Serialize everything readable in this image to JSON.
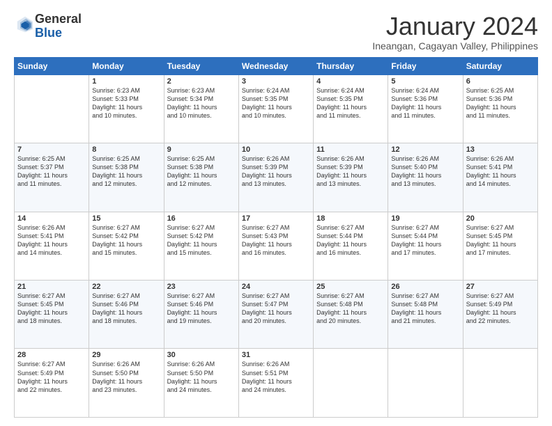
{
  "logo": {
    "general": "General",
    "blue": "Blue"
  },
  "title": "January 2024",
  "location": "Ineangan, Cagayan Valley, Philippines",
  "headers": [
    "Sunday",
    "Monday",
    "Tuesday",
    "Wednesday",
    "Thursday",
    "Friday",
    "Saturday"
  ],
  "weeks": [
    [
      {
        "day": "",
        "info": ""
      },
      {
        "day": "1",
        "info": "Sunrise: 6:23 AM\nSunset: 5:33 PM\nDaylight: 11 hours\nand 10 minutes."
      },
      {
        "day": "2",
        "info": "Sunrise: 6:23 AM\nSunset: 5:34 PM\nDaylight: 11 hours\nand 10 minutes."
      },
      {
        "day": "3",
        "info": "Sunrise: 6:24 AM\nSunset: 5:35 PM\nDaylight: 11 hours\nand 10 minutes."
      },
      {
        "day": "4",
        "info": "Sunrise: 6:24 AM\nSunset: 5:35 PM\nDaylight: 11 hours\nand 11 minutes."
      },
      {
        "day": "5",
        "info": "Sunrise: 6:24 AM\nSunset: 5:36 PM\nDaylight: 11 hours\nand 11 minutes."
      },
      {
        "day": "6",
        "info": "Sunrise: 6:25 AM\nSunset: 5:36 PM\nDaylight: 11 hours\nand 11 minutes."
      }
    ],
    [
      {
        "day": "7",
        "info": "Sunrise: 6:25 AM\nSunset: 5:37 PM\nDaylight: 11 hours\nand 11 minutes."
      },
      {
        "day": "8",
        "info": "Sunrise: 6:25 AM\nSunset: 5:38 PM\nDaylight: 11 hours\nand 12 minutes."
      },
      {
        "day": "9",
        "info": "Sunrise: 6:25 AM\nSunset: 5:38 PM\nDaylight: 11 hours\nand 12 minutes."
      },
      {
        "day": "10",
        "info": "Sunrise: 6:26 AM\nSunset: 5:39 PM\nDaylight: 11 hours\nand 13 minutes."
      },
      {
        "day": "11",
        "info": "Sunrise: 6:26 AM\nSunset: 5:39 PM\nDaylight: 11 hours\nand 13 minutes."
      },
      {
        "day": "12",
        "info": "Sunrise: 6:26 AM\nSunset: 5:40 PM\nDaylight: 11 hours\nand 13 minutes."
      },
      {
        "day": "13",
        "info": "Sunrise: 6:26 AM\nSunset: 5:41 PM\nDaylight: 11 hours\nand 14 minutes."
      }
    ],
    [
      {
        "day": "14",
        "info": "Sunrise: 6:26 AM\nSunset: 5:41 PM\nDaylight: 11 hours\nand 14 minutes."
      },
      {
        "day": "15",
        "info": "Sunrise: 6:27 AM\nSunset: 5:42 PM\nDaylight: 11 hours\nand 15 minutes."
      },
      {
        "day": "16",
        "info": "Sunrise: 6:27 AM\nSunset: 5:42 PM\nDaylight: 11 hours\nand 15 minutes."
      },
      {
        "day": "17",
        "info": "Sunrise: 6:27 AM\nSunset: 5:43 PM\nDaylight: 11 hours\nand 16 minutes."
      },
      {
        "day": "18",
        "info": "Sunrise: 6:27 AM\nSunset: 5:44 PM\nDaylight: 11 hours\nand 16 minutes."
      },
      {
        "day": "19",
        "info": "Sunrise: 6:27 AM\nSunset: 5:44 PM\nDaylight: 11 hours\nand 17 minutes."
      },
      {
        "day": "20",
        "info": "Sunrise: 6:27 AM\nSunset: 5:45 PM\nDaylight: 11 hours\nand 17 minutes."
      }
    ],
    [
      {
        "day": "21",
        "info": "Sunrise: 6:27 AM\nSunset: 5:45 PM\nDaylight: 11 hours\nand 18 minutes."
      },
      {
        "day": "22",
        "info": "Sunrise: 6:27 AM\nSunset: 5:46 PM\nDaylight: 11 hours\nand 18 minutes."
      },
      {
        "day": "23",
        "info": "Sunrise: 6:27 AM\nSunset: 5:46 PM\nDaylight: 11 hours\nand 19 minutes."
      },
      {
        "day": "24",
        "info": "Sunrise: 6:27 AM\nSunset: 5:47 PM\nDaylight: 11 hours\nand 20 minutes."
      },
      {
        "day": "25",
        "info": "Sunrise: 6:27 AM\nSunset: 5:48 PM\nDaylight: 11 hours\nand 20 minutes."
      },
      {
        "day": "26",
        "info": "Sunrise: 6:27 AM\nSunset: 5:48 PM\nDaylight: 11 hours\nand 21 minutes."
      },
      {
        "day": "27",
        "info": "Sunrise: 6:27 AM\nSunset: 5:49 PM\nDaylight: 11 hours\nand 22 minutes."
      }
    ],
    [
      {
        "day": "28",
        "info": "Sunrise: 6:27 AM\nSunset: 5:49 PM\nDaylight: 11 hours\nand 22 minutes."
      },
      {
        "day": "29",
        "info": "Sunrise: 6:26 AM\nSunset: 5:50 PM\nDaylight: 11 hours\nand 23 minutes."
      },
      {
        "day": "30",
        "info": "Sunrise: 6:26 AM\nSunset: 5:50 PM\nDaylight: 11 hours\nand 24 minutes."
      },
      {
        "day": "31",
        "info": "Sunrise: 6:26 AM\nSunset: 5:51 PM\nDaylight: 11 hours\nand 24 minutes."
      },
      {
        "day": "",
        "info": ""
      },
      {
        "day": "",
        "info": ""
      },
      {
        "day": "",
        "info": ""
      }
    ]
  ]
}
